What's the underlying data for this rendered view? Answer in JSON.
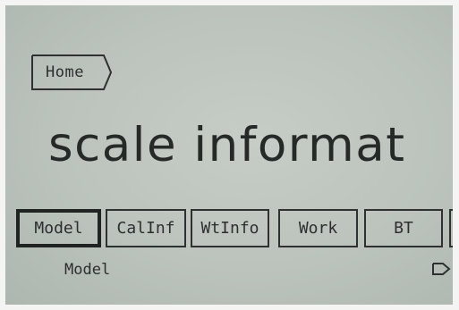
{
  "breadcrumb": {
    "home_label": "Home"
  },
  "main": {
    "title": "scale informat"
  },
  "softkeys": [
    {
      "label": "Model",
      "selected": true
    },
    {
      "label": "CalInf",
      "selected": false
    },
    {
      "label": "WtInfo",
      "selected": false
    },
    {
      "label": "Work",
      "selected": false
    },
    {
      "label": "BT",
      "selected": false
    }
  ],
  "status": {
    "hint": "Model"
  },
  "icons": {
    "more": "arrow-tab-right-icon"
  },
  "colors": {
    "lcd_background": "#bcc3bd",
    "lcd_foreground": "#262a28"
  }
}
